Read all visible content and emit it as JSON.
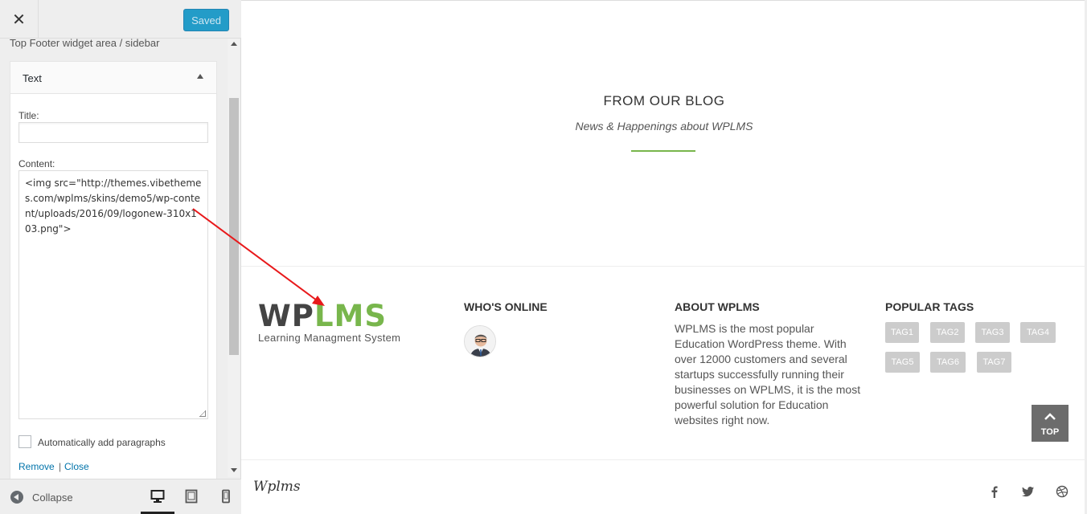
{
  "header": {
    "close_glyph": "✕",
    "saved_label": "Saved"
  },
  "section": {
    "title": "Top Footer widget area / sidebar"
  },
  "widget": {
    "title": "Text",
    "title_label": "Title:",
    "title_value": "",
    "content_label": "Content:",
    "content_value": "<img src=\"http://themes.vibethemes.com/wplms/skins/demo5/wp-content/uploads/2016/09/logonew-310x103.png\">",
    "autop_label": "Automatically add paragraphs",
    "autop_checked": false,
    "remove_label": "Remove",
    "separator": "|",
    "close_label": "Close"
  },
  "sidebar_footer": {
    "collapse_label": "Collapse",
    "active_device": "desktop"
  },
  "preview": {
    "blog_title": "FROM OUR BLOG",
    "blog_subtitle": "News & Happenings about WPLMS",
    "logo": {
      "wp": "WP",
      "lms": "LMS",
      "tagline": "Learning Managment System"
    },
    "whos_online_heading": "WHO'S ONLINE",
    "about_heading": "ABOUT WPLMS",
    "about_text": "WPLMS is the most popular Education WordPress theme. With over 12000 customers and several startups successfully running their businesses on WPLMS, it is the most powerful solution for Education websites right now.",
    "tags_heading": "POPULAR TAGS",
    "tags": [
      "TAG1",
      "TAG2",
      "TAG3",
      "TAG4",
      "TAG5",
      "TAG6",
      "TAG7"
    ],
    "top_label": "TOP",
    "footer_brand": "Wplms",
    "social": [
      "facebook-icon",
      "twitter-icon",
      "dribbble-icon"
    ]
  },
  "colors": {
    "accent_green": "#78b64c",
    "button_blue": "#008ec2",
    "link_blue": "#0073aa",
    "annotation_red": "#e8191b"
  }
}
